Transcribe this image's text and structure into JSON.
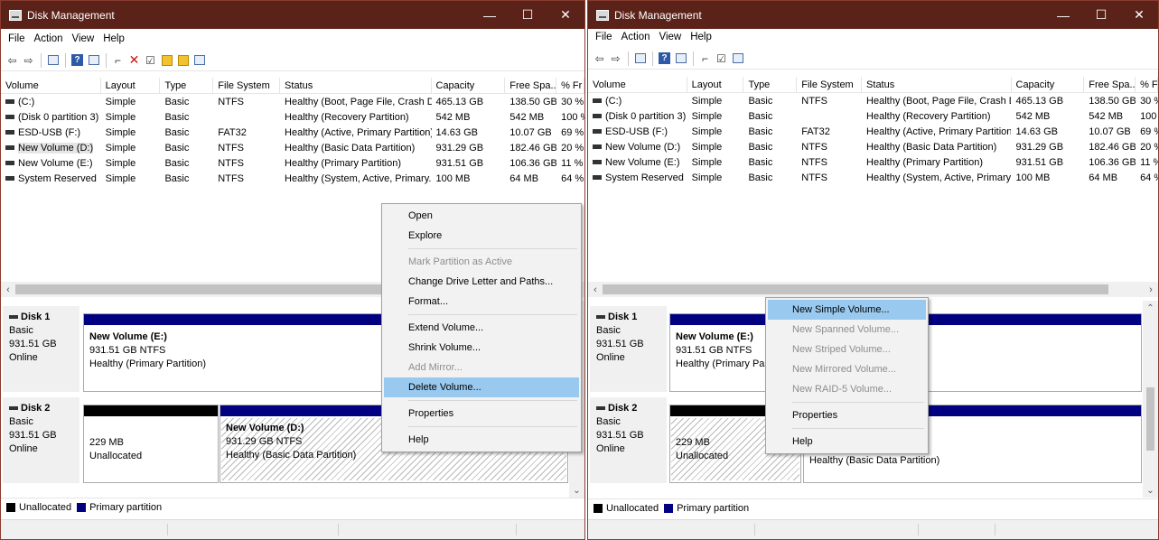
{
  "window_title": "Disk Management",
  "window_controls": {
    "minimize": "—",
    "maximize": "☐",
    "close": "✕"
  },
  "menus": [
    "File",
    "Action",
    "View",
    "Help"
  ],
  "columns": [
    "Volume",
    "Layout",
    "Type",
    "File System",
    "Status",
    "Capacity",
    "Free Spa...",
    "% Fr"
  ],
  "volumes": [
    {
      "volume": "(C:)",
      "layout": "Simple",
      "type": "Basic",
      "fs": "NTFS",
      "status": "Healthy (Boot, Page File, Crash D...",
      "capacity": "465.13 GB",
      "free": "138.50 GB",
      "pct": "30 %"
    },
    {
      "volume": "(Disk 0 partition 3)",
      "layout": "Simple",
      "type": "Basic",
      "fs": "",
      "status": "Healthy (Recovery Partition)",
      "capacity": "542 MB",
      "free": "542 MB",
      "pct": "100 %"
    },
    {
      "volume": "ESD-USB (F:)",
      "layout": "Simple",
      "type": "Basic",
      "fs": "FAT32",
      "status": "Healthy (Active, Primary Partition)",
      "capacity": "14.63 GB",
      "free": "10.07 GB",
      "pct": "69 %"
    },
    {
      "volume": "New Volume (D:)",
      "layout": "Simple",
      "type": "Basic",
      "fs": "NTFS",
      "status": "Healthy (Basic Data Partition)",
      "capacity": "931.29 GB",
      "free": "182.46 GB",
      "pct": "20 %"
    },
    {
      "volume": "New Volume (E:)",
      "layout": "Simple",
      "type": "Basic",
      "fs": "NTFS",
      "status": "Healthy (Primary Partition)",
      "capacity": "931.51 GB",
      "free": "106.36 GB",
      "pct": "11 %"
    },
    {
      "volume": "System Reserved",
      "layout": "Simple",
      "type": "Basic",
      "fs": "NTFS",
      "status": "Healthy (System, Active, Primary...",
      "capacity": "100 MB",
      "free": "64 MB",
      "pct": "64 %"
    }
  ],
  "disk1": {
    "name": "Disk 1",
    "kind": "Basic",
    "size": "931.51 GB",
    "state": "Online",
    "part": {
      "name": "New Volume  (E:)",
      "size": "931.51 GB NTFS",
      "status": "Healthy (Primary Partition)",
      "status_cut": "Healthy (Primary Parti"
    }
  },
  "disk2": {
    "name": "Disk 2",
    "kind": "Basic",
    "size": "931.51 GB",
    "state": "Online",
    "unalloc": {
      "size": "229 MB",
      "label": "Unallocated"
    },
    "part": {
      "name": "New Volume  (D:)",
      "size": "931.29 GB NTFS",
      "status": "Healthy (Basic Data Partition)"
    }
  },
  "legend": {
    "unallocated": "Unallocated",
    "primary": "Primary partition"
  },
  "colors": {
    "titlebar": "#5b2219",
    "primary": "#000080",
    "unallocated": "#000000",
    "highlight": "#99c9ef"
  },
  "ctx_left": [
    {
      "label": "Open"
    },
    {
      "label": "Explore"
    },
    {
      "sep": true
    },
    {
      "label": "Mark Partition as Active",
      "disabled": true
    },
    {
      "label": "Change Drive Letter and Paths..."
    },
    {
      "label": "Format..."
    },
    {
      "sep": true
    },
    {
      "label": "Extend Volume..."
    },
    {
      "label": "Shrink Volume..."
    },
    {
      "label": "Add Mirror...",
      "disabled": true
    },
    {
      "label": "Delete Volume...",
      "highlight": true
    },
    {
      "sep": true
    },
    {
      "label": "Properties"
    },
    {
      "sep": true
    },
    {
      "label": "Help"
    }
  ],
  "ctx_right": [
    {
      "label": "New Simple Volume...",
      "highlight": true
    },
    {
      "label": "New Spanned Volume...",
      "disabled": true
    },
    {
      "label": "New Striped Volume...",
      "disabled": true
    },
    {
      "label": "New Mirrored Volume...",
      "disabled": true
    },
    {
      "label": "New RAID-5 Volume...",
      "disabled": true
    },
    {
      "sep": true
    },
    {
      "label": "Properties"
    },
    {
      "sep": true
    },
    {
      "label": "Help"
    }
  ]
}
